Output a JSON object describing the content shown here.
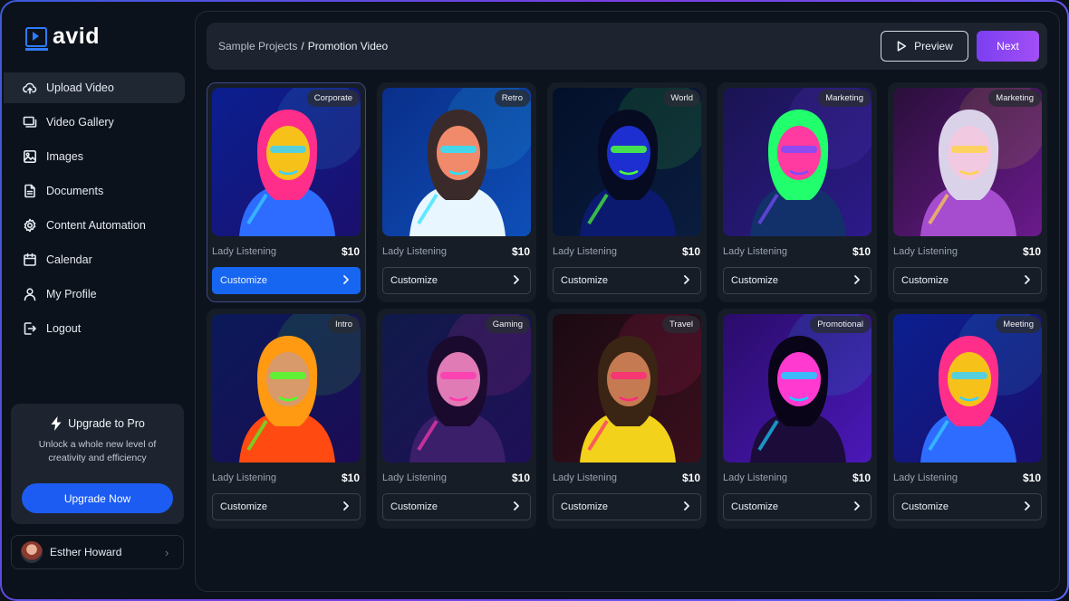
{
  "app": {
    "name": "avid"
  },
  "sidebar": {
    "items": [
      {
        "label": "Upload Video",
        "icon": "cloud-upload-icon",
        "active": true
      },
      {
        "label": "Video Gallery",
        "icon": "video-gallery-icon",
        "active": false
      },
      {
        "label": "Images",
        "icon": "image-icon",
        "active": false
      },
      {
        "label": "Documents",
        "icon": "document-icon",
        "active": false
      },
      {
        "label": "Content Automation",
        "icon": "gear-icon",
        "active": false
      },
      {
        "label": "Calendar",
        "icon": "calendar-icon",
        "active": false
      },
      {
        "label": "My Profile",
        "icon": "user-icon",
        "active": false
      },
      {
        "label": "Logout",
        "icon": "logout-icon",
        "active": false
      }
    ],
    "upgrade": {
      "title": "Upgrade to Pro",
      "description": "Unlock a whole new level of creativity and efficiency",
      "button": "Upgrade Now"
    },
    "user": {
      "name": "Esther Howard"
    }
  },
  "header": {
    "breadcrumb_parent": "Sample Projects",
    "breadcrumb_sep": "/",
    "breadcrumb_current": "Promotion Video",
    "preview_label": "Preview",
    "next_label": "Next"
  },
  "cards": [
    {
      "tag": "Corporate",
      "name": "Lady Listening",
      "price": "$10",
      "action": "Customize",
      "selected": true
    },
    {
      "tag": "Retro",
      "name": "Lady Listening",
      "price": "$10",
      "action": "Customize",
      "selected": false
    },
    {
      "tag": "World",
      "name": "Lady Listening",
      "price": "$10",
      "action": "Customize",
      "selected": false
    },
    {
      "tag": "Marketing",
      "name": "Lady Listening",
      "price": "$10",
      "action": "Customize",
      "selected": false
    },
    {
      "tag": "Marketing",
      "name": "Lady Listening",
      "price": "$10",
      "action": "Customize",
      "selected": false
    },
    {
      "tag": "Intro",
      "name": "Lady Listening",
      "price": "$10",
      "action": "Customize",
      "selected": false
    },
    {
      "tag": "Gaming",
      "name": "Lady Listening",
      "price": "$10",
      "action": "Customize",
      "selected": false
    },
    {
      "tag": "Travel",
      "name": "Lady Listening",
      "price": "$10",
      "action": "Customize",
      "selected": false
    },
    {
      "tag": "Promotional",
      "name": "Lady Listening",
      "price": "$10",
      "action": "Customize",
      "selected": false
    },
    {
      "tag": "Meeting",
      "name": "Lady Listening",
      "price": "$10",
      "action": "Customize",
      "selected": false
    }
  ],
  "colors": {
    "accent": "#1766f2",
    "next": "#8e47f3",
    "background": "#0c121b",
    "panel": "#1d242f"
  }
}
